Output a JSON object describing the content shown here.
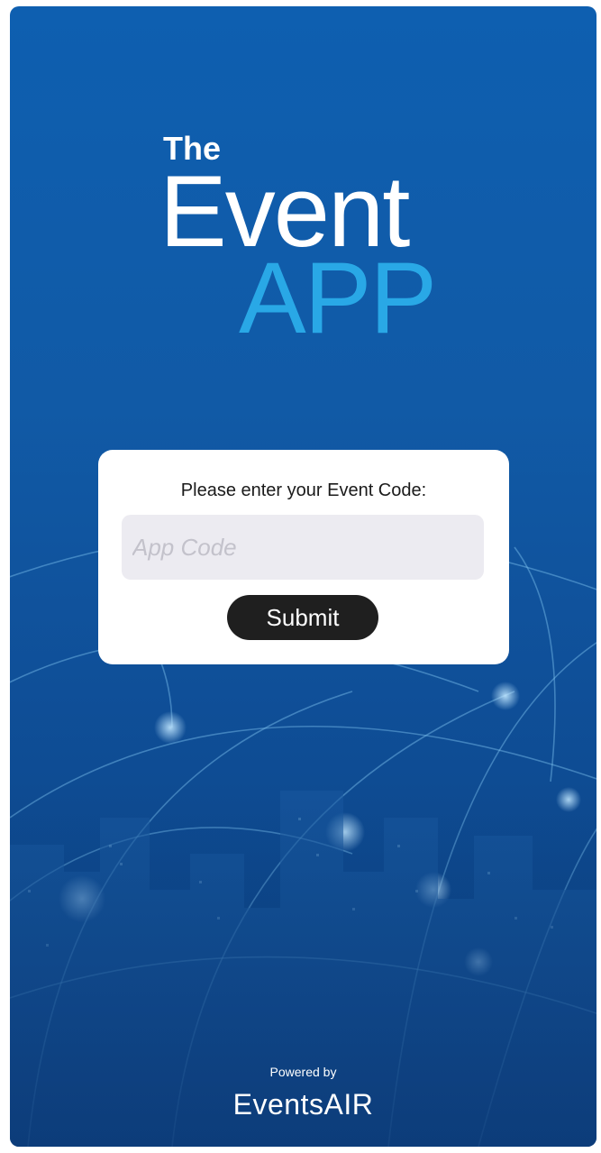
{
  "logo": {
    "line1": "The",
    "line2": "Event",
    "line3": "APP"
  },
  "card": {
    "prompt": "Please enter your Event Code:",
    "input_placeholder": "App Code",
    "input_value": "",
    "submit_label": "Submit"
  },
  "footer": {
    "powered_by": "Powered by",
    "brand": "EventsAIR"
  },
  "colors": {
    "background_top": "#0e5fb0",
    "background_bottom": "#0b3f7f",
    "logo_accent": "#29a8e6",
    "button": "#1f1f1f",
    "input_bg": "#ecebf1"
  }
}
